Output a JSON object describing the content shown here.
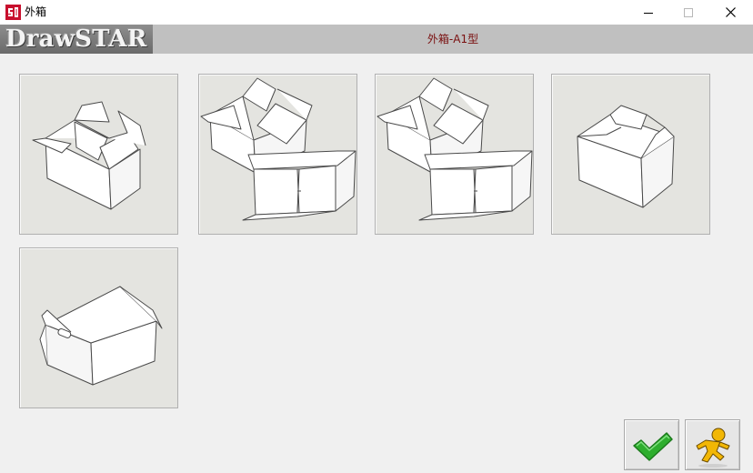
{
  "window": {
    "title": "外箱",
    "icon": "drawstar-app-icon"
  },
  "header": {
    "logo_text": "DrawSTAR",
    "title": "外箱-A1型"
  },
  "tiles": [
    {
      "icon": "box-open-flaps"
    },
    {
      "icon": "box-pair-open"
    },
    {
      "icon": "box-pair-open-alt"
    },
    {
      "icon": "box-closed-flaps"
    },
    {
      "icon": "box-with-handle"
    }
  ],
  "buttons": {
    "ok_icon": "green-check-icon",
    "exit_icon": "running-man-icon"
  },
  "colors": {
    "header_title": "#7a0f0f",
    "check_green": "#2eae2e",
    "runner_yellow": "#f2b705"
  }
}
